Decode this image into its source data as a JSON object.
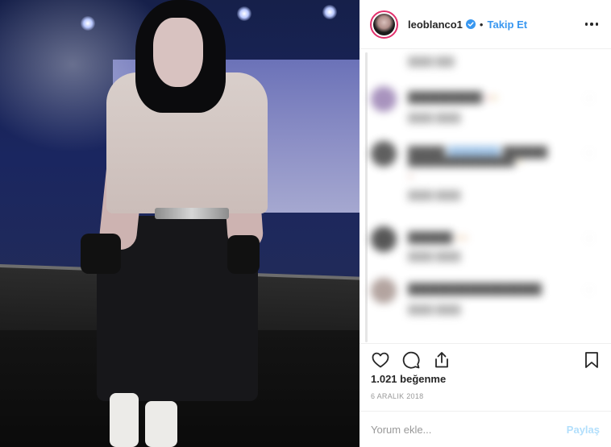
{
  "post": {
    "photo_alt": "",
    "author": {
      "username": "leoblanco1",
      "verified": true
    },
    "follow_label": "Takip Et",
    "separator": "•",
    "likes_text": "1.021 beğenme",
    "date_text": "6 ARALIK 2018",
    "comment_placeholder": "Yorum ekle...",
    "post_button_label": "Paylaş"
  },
  "icons": {
    "more": "more-options-icon",
    "like": "heart-icon",
    "comment": "comment-icon",
    "share": "share-icon",
    "save": "bookmark-icon",
    "verified": "verified-badge-icon"
  },
  "colors": {
    "link_blue": "#3897f0",
    "post_button_disabled": "#b2dffc",
    "verified_blue": "#3897f0",
    "avatar_ring": "#e1306c"
  }
}
